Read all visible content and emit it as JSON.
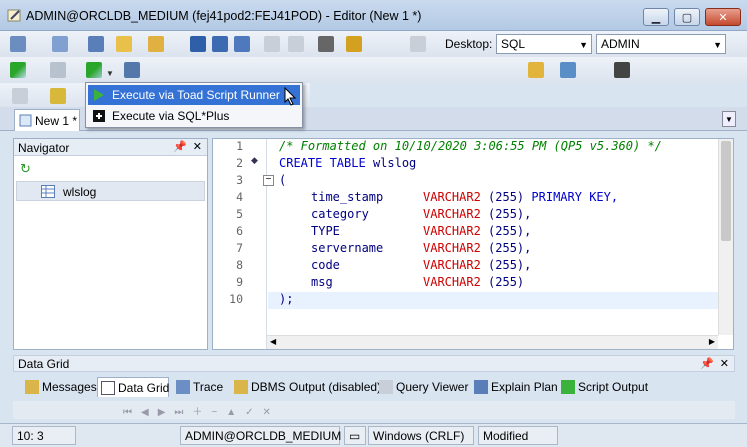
{
  "window": {
    "title": "ADMIN@ORCLDB_MEDIUM (fej41pod2:FEJ41POD) - Editor (New 1 *)"
  },
  "toolbar": {
    "desktop_label": "Desktop:",
    "desktop_value": "SQL",
    "connection_value": "ADMIN"
  },
  "execute_menu": {
    "items": [
      "Execute via Toad Script Runner",
      "Execute via SQL*Plus"
    ]
  },
  "doc_tab": {
    "label": "New 1 *"
  },
  "navigator": {
    "title": "Navigator",
    "tree_item": "wlslog"
  },
  "editor": {
    "line_numbers": [
      "1",
      "2",
      "3",
      "4",
      "5",
      "6",
      "7",
      "8",
      "9",
      "10"
    ],
    "comment": "/* Formatted on 10/10/2020 3:06:55 PM (QP5 v5.360) */",
    "create_kw": "CREATE TABLE",
    "table_name": "wlslog",
    "open_paren": "(",
    "columns": [
      {
        "name": "time_stamp",
        "type": "VARCHAR2",
        "size": "(255)",
        "extra": "PRIMARY KEY,"
      },
      {
        "name": "category",
        "type": "VARCHAR2",
        "size": "(255),",
        "extra": ""
      },
      {
        "name": "TYPE",
        "type": "VARCHAR2",
        "size": "(255),",
        "extra": ""
      },
      {
        "name": "servername",
        "type": "VARCHAR2",
        "size": "(255),",
        "extra": ""
      },
      {
        "name": "code",
        "type": "VARCHAR2",
        "size": "(255),",
        "extra": ""
      },
      {
        "name": "msg",
        "type": "VARCHAR2",
        "size": "(255)",
        "extra": ""
      }
    ],
    "close": ");"
  },
  "data_grid": {
    "title": "Data Grid",
    "tabs": [
      "Messages",
      "Data Grid",
      "Trace",
      "DBMS Output (disabled)",
      "Query Viewer",
      "Explain Plan",
      "Script Output"
    ]
  },
  "status_bar": {
    "position": "10:  3",
    "connection": "ADMIN@ORCLDB_MEDIUM",
    "line_ending": "Windows (CRLF)",
    "state": "Modified"
  }
}
